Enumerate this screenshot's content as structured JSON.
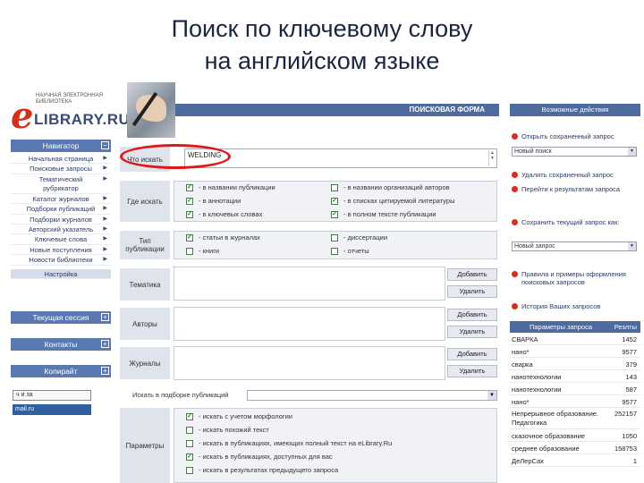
{
  "slide": {
    "title_line1": "Поиск по ключевому слову",
    "title_line2": "на английском языке"
  },
  "logo": {
    "letter": "e",
    "brand": "LIBRARY.RU",
    "tagline": "НАУЧНАЯ ЭЛЕКТРОННАЯ БИБЛИОТЕКА"
  },
  "left": {
    "navigator_label": "Навигатор",
    "nav_items": [
      "Начальная страница",
      "Поисковые запросы",
      "Тематический рубрикатор",
      "Каталог журналов",
      "Подборки публикаций",
      "Подборки журналов",
      "Авторский указатель",
      "Ключевые слова",
      "Новые поступления",
      "Новости библиотеки",
      "Настройка"
    ],
    "session_label": "Текущая сессия",
    "contacts_label": "Контакты",
    "copyright_label": "Копирайт",
    "counter1": "ч и за",
    "counter2": "mail.ru"
  },
  "form": {
    "header": "ПОИСКОВАЯ ФОРМА",
    "what_label": "Что искать",
    "what_value": "WELDING",
    "where_label": "Где искать",
    "where_options": [
      {
        "label": "- в названии публикации",
        "checked": true
      },
      {
        "label": "- в названии организаций авторов",
        "checked": false
      },
      {
        "label": "- в аннотации",
        "checked": true
      },
      {
        "label": "- в списках цитируемой литературы",
        "checked": true
      },
      {
        "label": "- в ключевых словах",
        "checked": true
      },
      {
        "label": "- в полном тексте публикации",
        "checked": true
      }
    ],
    "type_label": "Тип публикации",
    "type_options": [
      {
        "label": "- статьи в журналах",
        "checked": true
      },
      {
        "label": "- диссертации",
        "checked": false
      },
      {
        "label": "- книги",
        "checked": false
      },
      {
        "label": "- отчеты",
        "checked": false
      }
    ],
    "topic_label": "Тематика",
    "authors_label": "Авторы",
    "journals_label": "Журналы",
    "add_label": "Добавить",
    "remove_label": "Удалить",
    "collection_label": "Искать в подборке публикаций",
    "params_label": "Параметры",
    "params_options": [
      {
        "label": "- искать с учетом морфологии",
        "checked": true
      },
      {
        "label": "- искать похожий текст",
        "checked": false
      },
      {
        "label": "- искать в публикациях, имеющих полный текст на eLibrary.Ru",
        "checked": false
      },
      {
        "label": "- искать в публикациях, доступных для вас",
        "checked": true
      },
      {
        "label": "- искать в результатах предыдущего запроса",
        "checked": false
      }
    ]
  },
  "right": {
    "actions_header": "Возможные действия",
    "actions": [
      "Открыть сохраненный запрос",
      "Удалить сохраненный запрос",
      "Перейти к результатам запроса",
      "Сохранить текущий запрос как:",
      "Правила и примеры оформления поисковых запросов",
      "История Ваших запросов"
    ],
    "select1": "Новый поиск",
    "select2": "Новый запрос",
    "params_header_a": "Параметры запроса",
    "params_header_b": "Резлты",
    "rows": [
      {
        "k": "СВАРКА",
        "v": "1452"
      },
      {
        "k": "нано*",
        "v": "9577"
      },
      {
        "k": "сварка",
        "v": "379"
      },
      {
        "k": "нанотехнологии",
        "v": "143"
      },
      {
        "k": "нанотехнологии",
        "v": "587"
      },
      {
        "k": "нано*",
        "v": "9577"
      },
      {
        "k": "Непрерывное образование. Педагогика",
        "v": "252157"
      },
      {
        "k": "сказочное образование",
        "v": "1050"
      },
      {
        "k": "среднее образование",
        "v": "158753"
      },
      {
        "k": "ДеЛерСах",
        "v": "1"
      }
    ]
  },
  "colors": {
    "accent": "#4d6b9e",
    "highlight": "#e01818",
    "logo_red": "#d33019"
  }
}
